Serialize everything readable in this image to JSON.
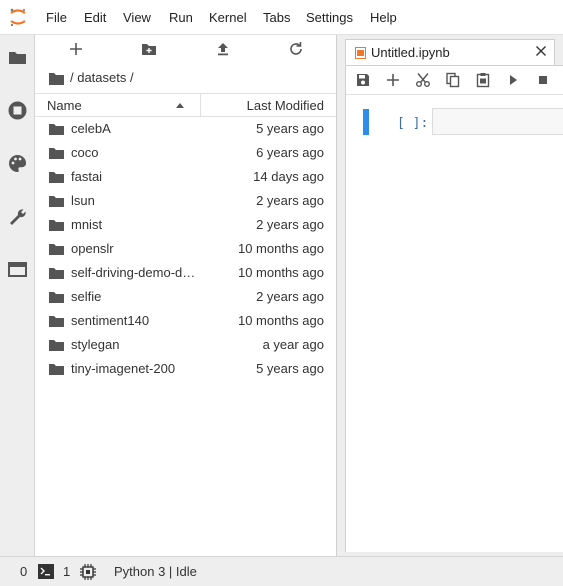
{
  "menu": [
    "File",
    "Edit",
    "View",
    "Run",
    "Kernel",
    "Tabs",
    "Settings",
    "Help"
  ],
  "activity_icons": [
    "folder-icon",
    "running-stop-icon",
    "palette-icon",
    "wrench-icon",
    "tabs-icon"
  ],
  "filebrowser": {
    "toolbar_icons": [
      "new-launcher-icon",
      "new-folder-icon",
      "upload-icon",
      "refresh-icon"
    ],
    "breadcrumb": "/ datasets /",
    "columns": {
      "name": "Name",
      "modified": "Last Modified"
    },
    "sort": "name-ascending",
    "items": [
      {
        "name": "celebA",
        "modified": "5 years ago"
      },
      {
        "name": "coco",
        "modified": "6 years ago"
      },
      {
        "name": "fastai",
        "modified": "14 days ago"
      },
      {
        "name": "lsun",
        "modified": "2 years ago"
      },
      {
        "name": "mnist",
        "modified": "2 years ago"
      },
      {
        "name": "openslr",
        "modified": "10 months ago"
      },
      {
        "name": "self-driving-demo-data",
        "modified": "10 months ago"
      },
      {
        "name": "selfie",
        "modified": "2 years ago"
      },
      {
        "name": "sentiment140",
        "modified": "10 months ago"
      },
      {
        "name": "stylegan",
        "modified": "a year ago"
      },
      {
        "name": "tiny-imagenet-200",
        "modified": "5 years ago"
      }
    ]
  },
  "notebook": {
    "tab_title": "Untitled.ipynb",
    "toolbar_icons": [
      "save-icon",
      "insert-cell-icon",
      "cut-icon",
      "copy-icon",
      "paste-icon",
      "run-icon",
      "stop-icon"
    ],
    "cell_prompt": "[ ]:",
    "cell_content": ""
  },
  "status": {
    "terminals": "0",
    "kernels": "1",
    "kernel_status": "Python 3 | Idle"
  },
  "colors": {
    "accent": "#2c8ee8",
    "brand_orange": "#f37726",
    "prompt": "#3b6ea8"
  }
}
